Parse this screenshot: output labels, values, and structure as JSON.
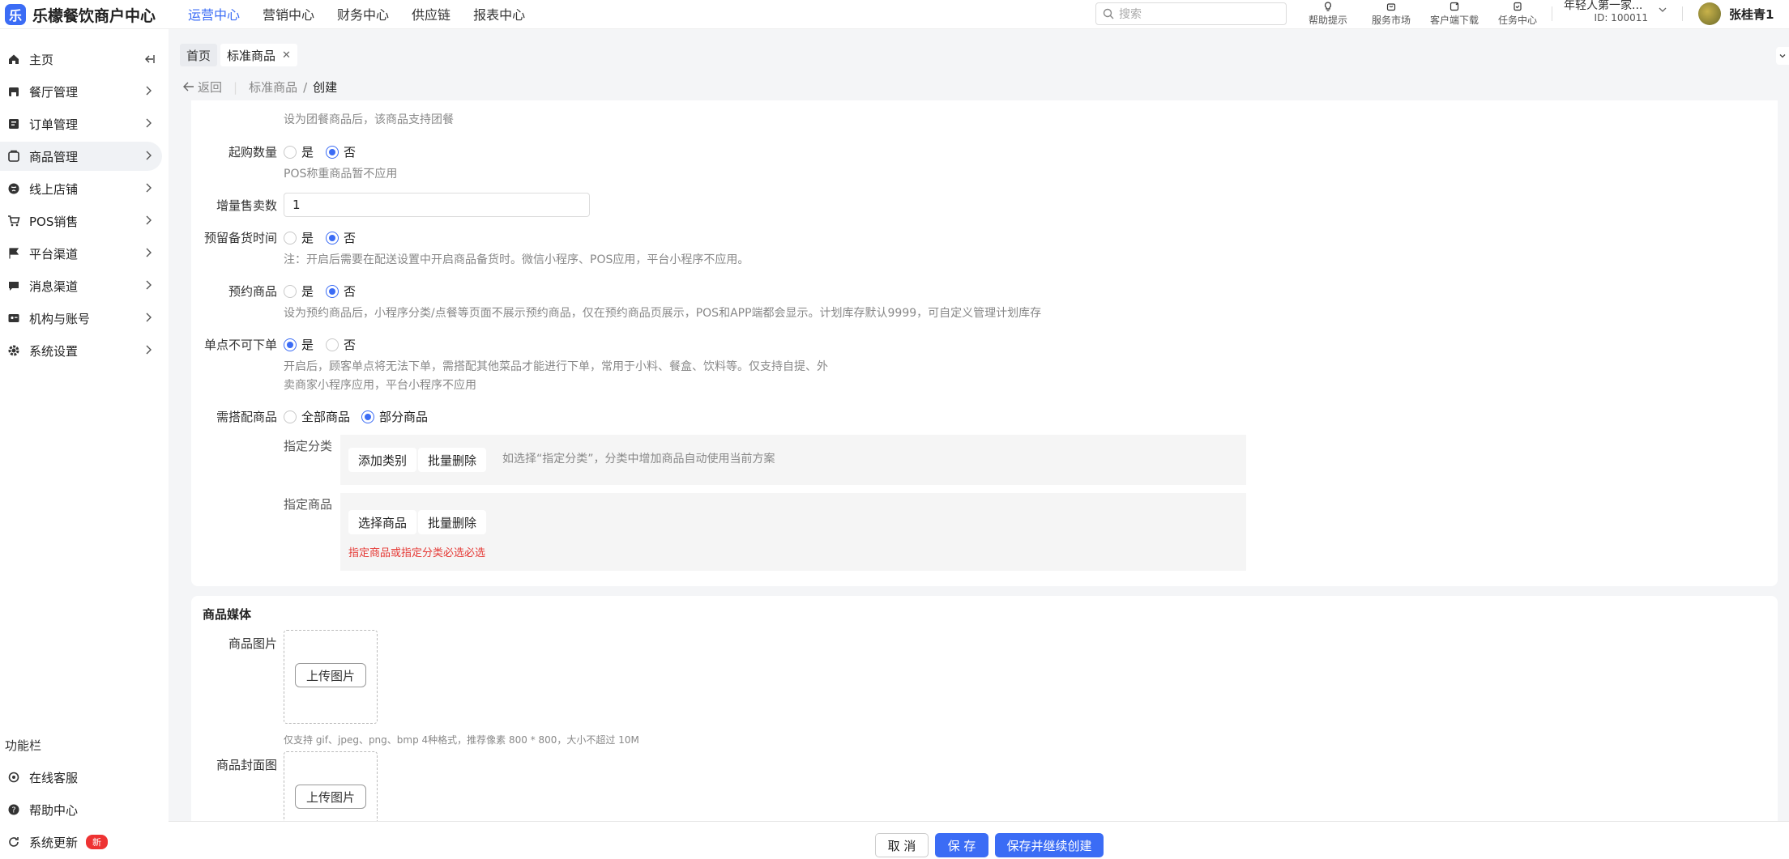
{
  "app": {
    "logo_char": "乐",
    "title": "乐檬餐饮商户中心"
  },
  "topnav": [
    "运营中心",
    "营销中心",
    "财务中心",
    "供应链",
    "报表中心"
  ],
  "search": {
    "placeholder": "搜索"
  },
  "tools": [
    {
      "label": "帮助提示",
      "icon": "lightbulb-icon"
    },
    {
      "label": "服务市场",
      "icon": "store-icon"
    },
    {
      "label": "客户端下载",
      "icon": "download-icon"
    },
    {
      "label": "任务中心",
      "icon": "task-icon"
    }
  ],
  "store": {
    "name": "年轻人第一家...",
    "id": "ID: 100011"
  },
  "user": {
    "name": "张桂青1"
  },
  "sidebar": {
    "items": [
      "主页",
      "餐厅管理",
      "订单管理",
      "商品管理",
      "线上店铺",
      "POS销售",
      "平台渠道",
      "消息渠道",
      "机构与账号",
      "系统设置"
    ],
    "func_title": "功能栏",
    "func_items": [
      "在线客服",
      "帮助中心",
      "系统更新"
    ],
    "new_badge": "新"
  },
  "tabs": {
    "home": "首页",
    "current": "标准商品",
    "close": "✕"
  },
  "breadcrumb": {
    "back": "返回",
    "parent": "标准商品",
    "sep": "/",
    "current": "创建"
  },
  "form": {
    "group_meal_hint": "设为团餐商品后，该商品支持团餐",
    "min_qty_label": "起购数量",
    "min_qty_hint": "POS称重商品暂不应用",
    "increment_label": "增量售卖数",
    "increment_value": "1",
    "stock_time_label": "预留备货时间",
    "stock_time_hint": "注：开启后需要在配送设置中开启商品备货时。微信小程序、POS应用，平台小程序不应用。",
    "reserve_label": "预约商品",
    "reserve_hint": "设为预约商品后，小程序分类/点餐等页面不展示预约商品，仅在预约商品页展示，POS和APP端都会显示。计划库存默认9999，可自定义管理计划库存",
    "single_label": "单点不可下单",
    "single_hint1": "开启后，顾客单点将无法下单，需搭配其他菜品才能进行下单，常用于小料、餐盒、饮料等。仅支持自提、外",
    "single_hint2": "卖商家小程序应用，平台小程序不应用",
    "pair_label": "需搭配商品",
    "pair_all": "全部商品",
    "pair_part": "部分商品",
    "yes": "是",
    "no": "否",
    "cat_label": "指定分类",
    "add_cat": "添加类别",
    "batch_delete": "批量删除",
    "cat_hint": "如选择“指定分类”，分类中增加商品自动使用当前方案",
    "prod_label": "指定商品",
    "select_prod": "选择商品",
    "error": "指定商品或指定分类必选必选"
  },
  "media": {
    "title": "商品媒体",
    "image_label": "商品图片",
    "upload": "上传图片",
    "image_hint": "仅支持 gif、jpeg、png、bmp 4种格式，推荐像素 800 * 800，大小不超过 10M",
    "cover_label": "商品封面图"
  },
  "footer": {
    "cancel": "取 消",
    "save": "保 存",
    "save_continue": "保存并继续创建"
  },
  "colors": {
    "primary": "#3b6cf5",
    "error": "#e53935",
    "badge": "#ee3333"
  }
}
